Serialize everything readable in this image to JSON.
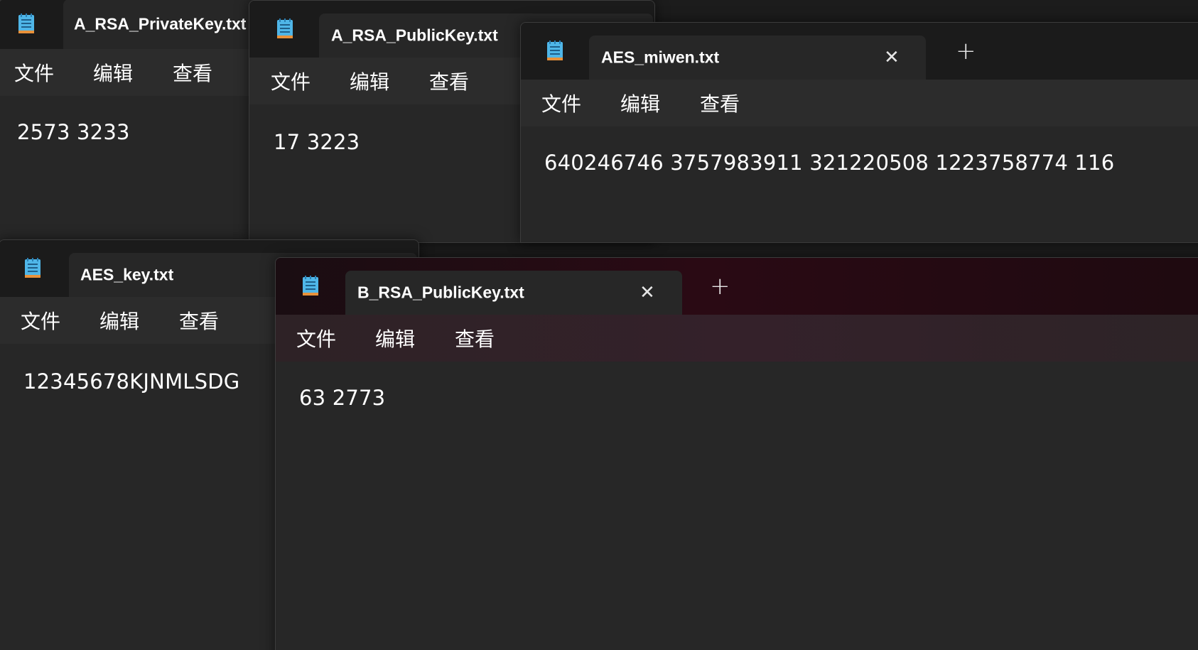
{
  "menu": {
    "file": "文件",
    "edit": "编辑",
    "view": "查看"
  },
  "colors": {
    "icon_body": "#4fb6e8",
    "icon_line": "#1e5f8a",
    "icon_bottom": "#e8913a",
    "tint": "#2a0a14"
  },
  "windows": [
    {
      "id": "a_private",
      "tab_title": "A_RSA_PrivateKey.txt",
      "content": "2573 3233"
    },
    {
      "id": "a_public",
      "tab_title": "A_RSA_PublicKey.txt",
      "content": "17 3223"
    },
    {
      "id": "aes_miwen",
      "tab_title": "AES_miwen.txt",
      "content": "640246746 3757983911 321220508 1223758774 116",
      "plus_label": "+"
    },
    {
      "id": "aes_key",
      "tab_title": "AES_key.txt",
      "content": "12345678KJNMLSDG"
    },
    {
      "id": "b_public",
      "tab_title": "B_RSA_PublicKey.txt",
      "content": "63 2773",
      "plus_label": "+"
    }
  ]
}
